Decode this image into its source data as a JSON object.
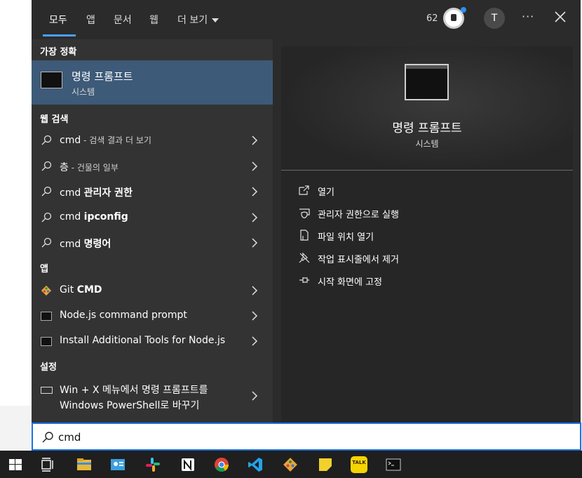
{
  "tabs": [
    {
      "label": "모두",
      "active": true
    },
    {
      "label": "앱"
    },
    {
      "label": "문서"
    },
    {
      "label": "웹"
    },
    {
      "label": "더 보기"
    }
  ],
  "header": {
    "points": "62",
    "avatar_initial": "T",
    "more": "···"
  },
  "best_match": {
    "heading": "가장 정확",
    "title": "명령 프롬프트",
    "subtitle": "시스템"
  },
  "web_search": {
    "heading": "웹 검색",
    "items": [
      {
        "main": "cmd",
        "hint": " - 검색 결과 더 보기"
      },
      {
        "main": "층",
        "hint": " - 건물의 일부"
      },
      {
        "prefix": "cmd ",
        "bold": "관리자 권한"
      },
      {
        "prefix": "cmd ",
        "bold": "ipconfig"
      },
      {
        "prefix": "cmd ",
        "bold": "명령어"
      }
    ]
  },
  "apps": {
    "heading": "앱",
    "items": [
      {
        "prefix": "Git ",
        "bold": "CMD"
      },
      {
        "label": "Node.js command prompt"
      },
      {
        "label": "Install Additional Tools for Node.js"
      }
    ]
  },
  "settings": {
    "heading": "설정",
    "item_line1": "Win + X 메뉴에서 명령 프롬프트를",
    "item_line2": "Windows PowerShell로 바꾸기"
  },
  "detail": {
    "title": "명령 프롬프트",
    "subtitle": "시스템",
    "actions": [
      {
        "label": "열기",
        "icon": "open-icon"
      },
      {
        "label": "관리자 권한으로 실행",
        "icon": "shield-icon"
      },
      {
        "label": "파일 위치 열기",
        "icon": "file-location-icon"
      },
      {
        "label": "작업 표시줄에서 제거",
        "icon": "unpin-icon"
      },
      {
        "label": "시작 화면에 고정",
        "icon": "pin-icon"
      }
    ]
  },
  "search": {
    "value": "cmd"
  },
  "taskbar": {
    "icons": [
      "windows-start-icon",
      "task-view-icon",
      "file-explorer-icon",
      "contacts-app-icon",
      "slack-icon",
      "notion-icon",
      "chrome-icon",
      "vscode-icon",
      "git-icon",
      "sticky-notes-icon",
      "kakaotalk-icon",
      "terminal-icon"
    ],
    "kakao_label": "TALK"
  },
  "colors": {
    "accent": "#1a73e8",
    "selected": "#3d5a78",
    "panel": "#2b2b2b"
  }
}
